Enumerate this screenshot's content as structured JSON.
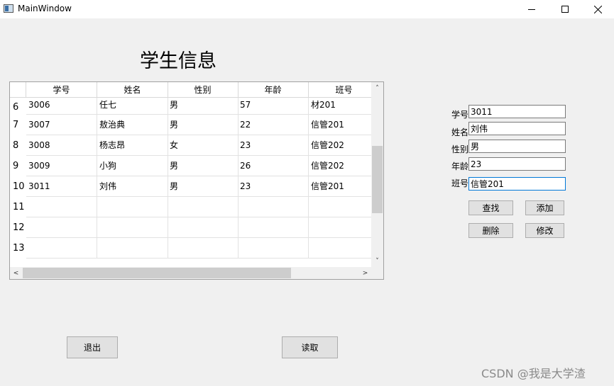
{
  "window": {
    "title": "MainWindow",
    "icons": {
      "app": "app-window-icon",
      "minimize": "minimize-icon",
      "maximize": "maximize-icon",
      "close": "close-icon"
    }
  },
  "page": {
    "title": "学生信息"
  },
  "table": {
    "columns": [
      "学号",
      "姓名",
      "性别",
      "年龄",
      "班号"
    ],
    "row_numbers": [
      "6",
      "7",
      "8",
      "9",
      "10",
      "11",
      "12",
      "13"
    ],
    "rows": [
      [
        "3006",
        "任七",
        "男",
        "57",
        "材201"
      ],
      [
        "3007",
        "敖治典",
        "男",
        "22",
        "信管201"
      ],
      [
        "3008",
        "杨志昂",
        "女",
        "23",
        "信管202"
      ],
      [
        "3009",
        "小狗",
        "男",
        "26",
        "信管202"
      ],
      [
        "3011",
        "刘伟",
        "男",
        "23",
        "信管201"
      ],
      [
        "",
        "",
        "",
        "",
        ""
      ],
      [
        "",
        "",
        "",
        "",
        ""
      ],
      [
        "",
        "",
        "",
        "",
        ""
      ]
    ],
    "scroll_arrows": {
      "up": "˄",
      "down": "˅",
      "left": "<",
      "right": ">"
    }
  },
  "form": {
    "fields": [
      {
        "label": "学号",
        "value": "3011"
      },
      {
        "label": "姓名",
        "value": "刘伟"
      },
      {
        "label": "性别",
        "value": "男"
      },
      {
        "label": "年龄",
        "value": "23"
      },
      {
        "label": "班号",
        "value": "信管201"
      }
    ],
    "buttons": {
      "search": "查找",
      "add": "添加",
      "delete": "删除",
      "modify": "修改"
    }
  },
  "bottom_buttons": {
    "exit": "退出",
    "read": "读取"
  },
  "watermark": "CSDN @我是大学渣"
}
